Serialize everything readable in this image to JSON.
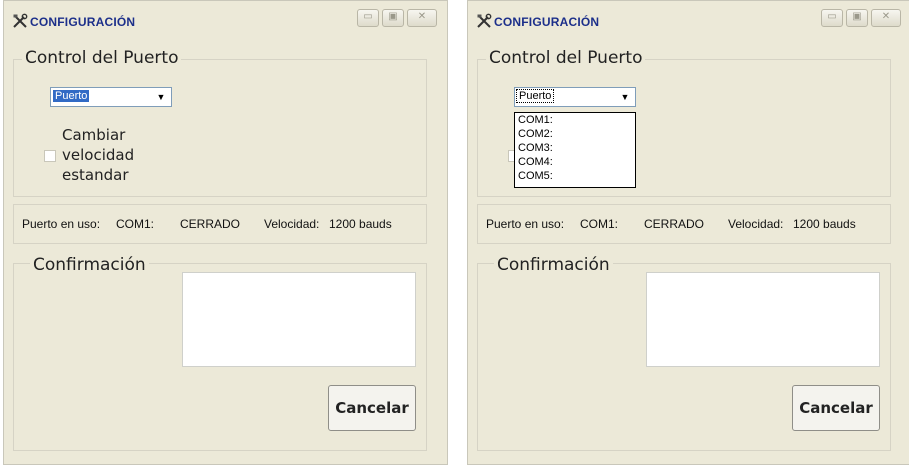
{
  "windows": [
    {
      "title": "CONFIGURACIÓN",
      "port_group_title": "Control del  Puerto",
      "port_combo_value": "Puerto",
      "checkbox_label_lines": [
        "Cambiar",
        "velocidad",
        "estandar"
      ],
      "status": {
        "label": "Puerto en uso:",
        "port": "COM1:",
        "state": "CERRADO",
        "speed_label": "Velocidad:",
        "speed_value": "1200 bauds"
      },
      "confirm_group_title": "Confirmación",
      "confirm_text": "",
      "cancel_label": "Cancelar"
    },
    {
      "title": "CONFIGURACIÓN",
      "port_group_title": "Control del  Puerto",
      "port_combo_value": "Puerto",
      "dropdown_options": [
        "COM1:",
        "COM2:",
        "COM3:",
        "COM4:",
        "COM5:"
      ],
      "status": {
        "label": "Puerto en uso:",
        "port": "COM1:",
        "state": "CERRADO",
        "speed_label": "Velocidad:",
        "speed_value": "1200 bauds"
      },
      "confirm_group_title": "Confirmación",
      "confirm_text": "",
      "cancel_label": "Cancelar"
    }
  ],
  "icons": {
    "app_icon": "tools-icon",
    "minimize": "minimize-icon",
    "maximize": "maximize-icon",
    "close": "close-icon",
    "dropdown": "chevron-down-icon"
  }
}
